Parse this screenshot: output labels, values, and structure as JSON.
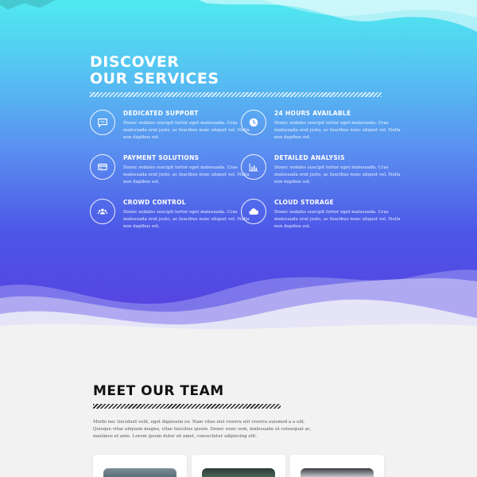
{
  "services_section": {
    "title_line1": "DISCOVER",
    "title_line2": "OUR SERVICES",
    "items": [
      {
        "title": "DEDICATED SUPPORT",
        "icon": "chat-icon",
        "desc": "Donec sodales suscipit tortor eget malesuada. Cras malesuada erat justo, ac faucibus nunc aliquet vel. Nulla non dapibus est."
      },
      {
        "title": "24 HOURS AVAILABLE",
        "icon": "clock-icon",
        "desc": "Donec sodales suscipit tortor eget malesuada. Cras malesuada erat justo, ac faucibus nunc aliquet vel. Nulla non dapibus est."
      },
      {
        "title": "PAYMENT SOLUTIONS",
        "icon": "credit-card-icon",
        "desc": "Donec sodales suscipit tortor eget malesuada. Cras malesuada erat justo, ac faucibus nunc aliquet vel. Nulla non dapibus est."
      },
      {
        "title": "DETAILED ANALYSIS",
        "icon": "bar-chart-icon",
        "desc": "Donec sodales suscipit tortor eget malesuada. Cras malesuada erat justo, ac faucibus nunc aliquet vel. Nulla non dapibus est."
      },
      {
        "title": "CROWD CONTROL",
        "icon": "users-icon",
        "desc": "Donec sodales suscipit tortor eget malesuada. Cras malesuada erat justo, ac faucibus nunc aliquet vel. Nulla non dapibus est."
      },
      {
        "title": "CLOUD STORAGE",
        "icon": "cloud-icon",
        "desc": "Donec sodales suscipit tortor eget malesuada. Cras malesuada erat justo, ac faucibus nunc aliquet vel. Nulla non dapibus est."
      }
    ]
  },
  "team_section": {
    "title": "MEET OUR TEAM",
    "desc": "Morbi nec tincidunt velit, eget dignissim ex. Nam vitae nisl viverra elit viverra euismod a a elit. Quisque vitae aliquam magna, vitae faucibus ipsum. Donec nunc sem, malesuada ut consequat ac, maximus et ante. Lorem ipsum dolor sit amet, consectetur adipiscing elit."
  },
  "colors": {
    "gradient_top": "#4fe9f0",
    "gradient_bottom": "#5a3fe0",
    "background": "#f2f2f2"
  }
}
